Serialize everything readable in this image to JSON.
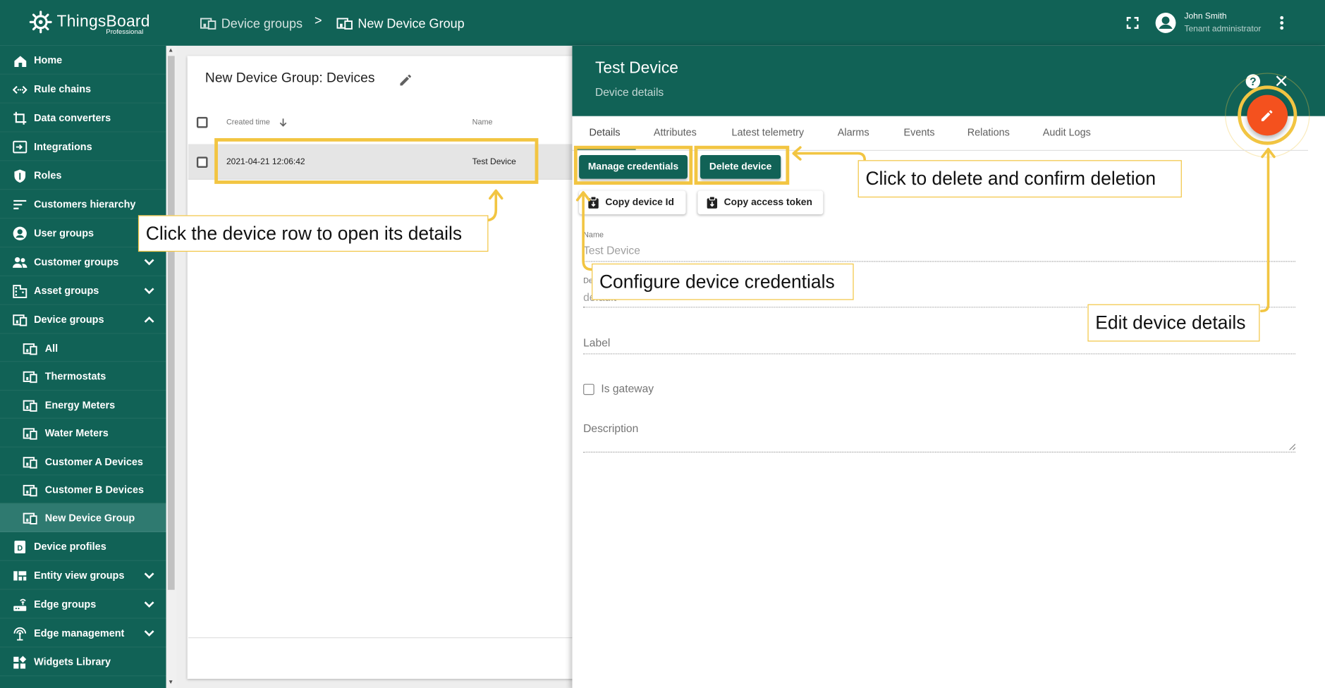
{
  "app": {
    "brand": "ThingsBoard",
    "edition": "Professional"
  },
  "topbar": {
    "breadcrumb": [
      {
        "label": "Device groups",
        "icon": "devices-icon"
      },
      {
        "label": "New Device Group",
        "icon": "devices-icon"
      }
    ],
    "separator": ">",
    "user_name": "John Smith",
    "user_role": "Tenant administrator"
  },
  "sidebar": {
    "items": [
      {
        "label": "Home",
        "icon": "home-icon"
      },
      {
        "label": "Rule chains",
        "icon": "rule-chains-icon"
      },
      {
        "label": "Data converters",
        "icon": "converters-icon"
      },
      {
        "label": "Integrations",
        "icon": "integrations-icon"
      },
      {
        "label": "Roles",
        "icon": "shield-icon"
      },
      {
        "label": "Customers hierarchy",
        "icon": "hierarchy-icon"
      },
      {
        "label": "User groups",
        "icon": "account-icon"
      },
      {
        "label": "Customer groups",
        "icon": "people-icon",
        "expandable": true
      },
      {
        "label": "Asset groups",
        "icon": "domain-icon",
        "expandable": true
      },
      {
        "label": "Device groups",
        "icon": "devices-icon",
        "expanded": true
      },
      {
        "label": "All",
        "icon": "devices-icon",
        "sub": true
      },
      {
        "label": "Thermostats",
        "icon": "devices-icon",
        "sub": true
      },
      {
        "label": "Energy Meters",
        "icon": "devices-icon",
        "sub": true
      },
      {
        "label": "Water Meters",
        "icon": "devices-icon",
        "sub": true
      },
      {
        "label": "Customer A Devices",
        "icon": "devices-icon",
        "sub": true
      },
      {
        "label": "Customer B Devices",
        "icon": "devices-icon",
        "sub": true
      },
      {
        "label": "New Device Group",
        "icon": "devices-icon",
        "sub": true,
        "active": true
      },
      {
        "label": "Device profiles",
        "icon": "device-profile-icon"
      },
      {
        "label": "Entity view groups",
        "icon": "view-quilt-icon",
        "expandable": true
      },
      {
        "label": "Edge groups",
        "icon": "router-icon",
        "expandable": true
      },
      {
        "label": "Edge management",
        "icon": "settings-input-antenna-icon",
        "expandable": true
      },
      {
        "label": "Widgets Library",
        "icon": "widgets-icon"
      }
    ]
  },
  "devices_table": {
    "title": "New Device Group: Devices",
    "columns": [
      "Created time",
      "Name"
    ],
    "rows": [
      {
        "created_time": "2021-04-21 12:06:42",
        "name": "Test Device"
      }
    ]
  },
  "details": {
    "title": "Test Device",
    "subtitle": "Device details",
    "tabs": [
      "Details",
      "Attributes",
      "Latest telemetry",
      "Alarms",
      "Events",
      "Relations",
      "Audit Logs"
    ],
    "active_tab": "Details",
    "buttons": {
      "manage_credentials": "Manage credentials",
      "delete_device": "Delete device",
      "copy_device_id": "Copy device Id",
      "copy_access_token": "Copy access token"
    },
    "fields": {
      "name_label": "Name",
      "name_value": "Test Device",
      "profile_label": "De",
      "profile_value": "default",
      "label_label": "Label",
      "gateway_label": "Is gateway",
      "description_label": "Description"
    }
  },
  "callouts": {
    "row": "Click the device row to open its details",
    "delete": "Click to delete and confirm deletion",
    "credentials": "Configure device credentials",
    "edit": "Edit device details"
  },
  "colors": {
    "primary": "#116256",
    "accent": "#f4511e",
    "highlight": "#f2c542"
  }
}
